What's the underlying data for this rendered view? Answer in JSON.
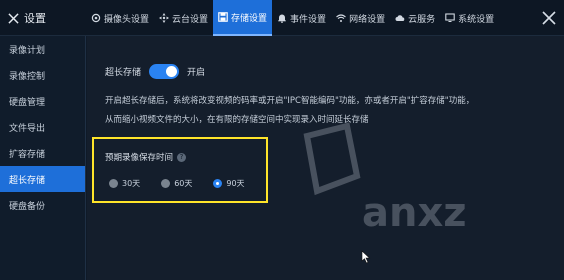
{
  "brand": {
    "title": "设置",
    "icon": "tools-icon"
  },
  "tabs": [
    {
      "label": "摄像头设置",
      "icon": "camera-icon"
    },
    {
      "label": "云台设置",
      "icon": "ptz-icon"
    },
    {
      "label": "存储设置",
      "icon": "save-icon",
      "active": true
    },
    {
      "label": "事件设置",
      "icon": "bell-icon"
    },
    {
      "label": "网络设置",
      "icon": "wifi-icon"
    },
    {
      "label": "云服务",
      "icon": "cloud-icon"
    },
    {
      "label": "系统设置",
      "icon": "monitor-icon"
    }
  ],
  "sidebar": {
    "items": [
      {
        "label": "录像计划"
      },
      {
        "label": "录像控制"
      },
      {
        "label": "硬盘管理"
      },
      {
        "label": "文件导出"
      },
      {
        "label": "扩容存储"
      },
      {
        "label": "超长存储",
        "active": true
      },
      {
        "label": "硬盘备份"
      }
    ]
  },
  "main": {
    "toggle": {
      "label": "超长存储",
      "state_text": "开启",
      "on": true
    },
    "description_1": "开启超长存储后，系统将改变视频的码率或开启\"IPC智能编码\"功能，亦或者开启\"扩容存储\"功能，",
    "description_2": "从而缩小视频文件的大小，在有限的存储空间中实现录入时间延长存储",
    "retention": {
      "label": "预期录像保存时间",
      "options": [
        {
          "label": "30天",
          "selected": false
        },
        {
          "label": "60天",
          "selected": false
        },
        {
          "label": "90天",
          "selected": true
        }
      ]
    }
  },
  "colors": {
    "accent": "#1e6fd9",
    "highlight": "#ffe52a",
    "background": "#141e2c"
  }
}
